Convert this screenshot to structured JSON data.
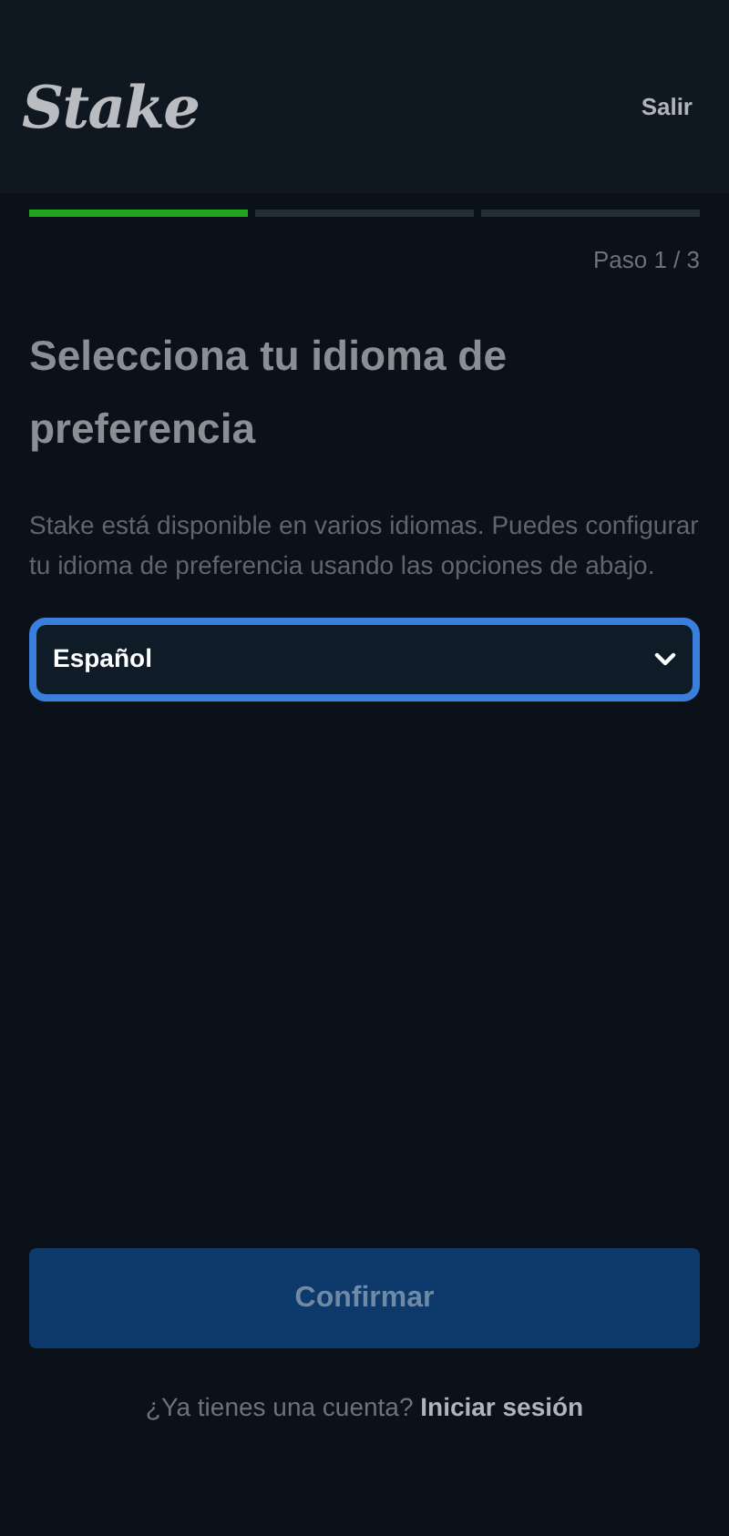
{
  "header": {
    "logo": "Stake",
    "exit": "Salir"
  },
  "progress": {
    "steps": [
      {
        "done": true
      },
      {
        "done": false
      },
      {
        "done": false
      }
    ],
    "label": "Paso 1 / 3"
  },
  "title": "Selecciona tu idioma de preferencia",
  "description": "Stake está disponible en varios idiomas. Puedes configurar tu idioma de preferencia usando las opciones de abajo.",
  "language_select": {
    "value": "Español",
    "focused": true
  },
  "confirm_button": {
    "label": "Confirmar",
    "disabled": true
  },
  "footer": {
    "question": "¿Ya tienes una cuenta?",
    "link": "Iniciar sesión"
  }
}
